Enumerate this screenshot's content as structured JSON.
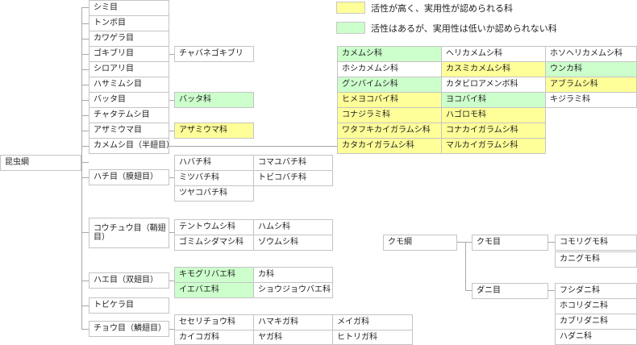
{
  "legend": {
    "high": "活性が高く、実用性が認められる科",
    "low": "活性はあるが、実用性は低いか認められない科",
    "high_color": "#ffff99",
    "low_color": "#ccffcc"
  },
  "root": "昆虫綱",
  "orders": {
    "shimi": "シミ目",
    "tonbo": "トンボ目",
    "kawagera": "カワゲラ目",
    "gokiburi": "ゴキブリ目",
    "shiroari": "シロアリ目",
    "hasamimushi": "ハサミムシ目",
    "batta": "バッタ目",
    "chatatemushi": "チャタテムシ目",
    "azamiuma": "アザミウマ目",
    "kamemushi": "カメムシ目（半翅目）",
    "hachi": "ハチ目（膜翅目）",
    "kouchu": "コウチュウ目（鞘翅目）",
    "hae": "ハエ目（双翅目）",
    "tobikera": "トビケラ目",
    "chou": "チョウ目（鱗翅目）"
  },
  "families": {
    "chabane": "チャバネゴキブリ",
    "batta": "バッタ科",
    "azamiuma": "アザミウマ科",
    "hemiptera": [
      [
        "カメムシ科",
        "ヘリカメムシ科",
        "ホソヘリカメムシ科"
      ],
      [
        "ホシカメムシ科",
        "カスミカメムシ科",
        "ウンカ科"
      ],
      [
        "グンバイムシ科",
        "カタビロアメンボ科",
        "アブラムシ科"
      ],
      [
        "ヒメヨコバイ科",
        "ヨコバイ科",
        "キジラミ科"
      ],
      [
        "コナジラミ科",
        "ハゴロモ科",
        ""
      ],
      [
        "ワタフキカイガラムシ科",
        "コナカイガラムシ科",
        ""
      ],
      [
        "カタカイガラムシ科",
        "マルカイガラムシ科",
        ""
      ]
    ],
    "hymenoptera": [
      "ハバチ科",
      "コマユバチ科",
      "ミツバチ科",
      "トビコバチ科",
      "ツヤコバチ科"
    ],
    "coleoptera": [
      "テントウムシ科",
      "ハムシ科",
      "ゴミムシダマシ科",
      "ゾウムシ科"
    ],
    "diptera": [
      "キモグリバエ科",
      "カ科",
      "イエバエ科",
      "ショウジョウバエ科"
    ],
    "lepidoptera": [
      "セセリチョウ科",
      "ハマキガ科",
      "メイガ科",
      "カイコガ科",
      "ヤガ科",
      "ヒトリガ科"
    ]
  },
  "arachnida": {
    "root": "クモ綱",
    "spider_order": "クモ目",
    "mite_order": "ダニ目",
    "spiders": [
      "コモリグモ科",
      "カニグモ科"
    ],
    "mites": [
      "フシダニ科",
      "ホコリダニ科",
      "カブリダニ科",
      "ハダニ科"
    ]
  }
}
